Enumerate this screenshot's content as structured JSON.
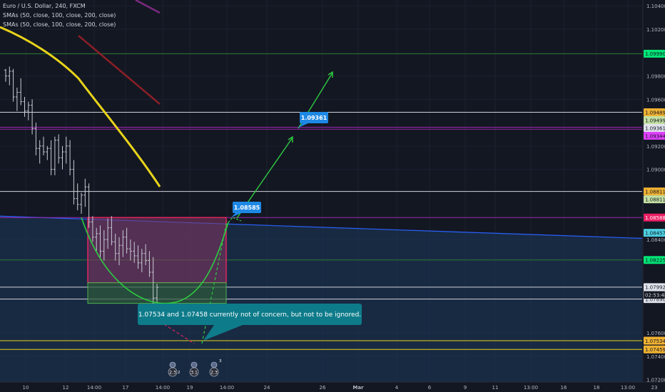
{
  "header": {
    "symbol": "Euro / U.S. Dollar, 240, FXCM",
    "indicators": [
      "SMAs (50, close, 100, close, 200, close)",
      "SMAs (50, close, 100, close, 200, close)"
    ]
  },
  "colors": {
    "background": "#131722",
    "candle": "#c8cbd2",
    "sma50": "#e8d31a",
    "sma100": "#8b1f26",
    "sma200": "#7a2a7e",
    "trendline": "#2962ff",
    "pink_zone": "#e0245e",
    "green_zone": "#4caf50",
    "projection": "#2ecc40",
    "label_blue": "#1e88e5",
    "note_bg": "#0e7b8a"
  },
  "annotations": {
    "label_upper": "1.09361",
    "label_mid": "1.08585",
    "note": "1.07534 and 1.07458 currently not of concern, but not to be ignored.",
    "bubbles": [
      {
        "value": "2.3",
        "sub": "2"
      },
      {
        "value": "3.1",
        "sub": ""
      },
      {
        "value": "2.3",
        "sub": "3"
      }
    ]
  },
  "chart_data": {
    "type": "candlestick",
    "title": "Euro / U.S. Dollar, 240, FXCM",
    "ylim": [
      1.0718,
      1.1045
    ],
    "x_ticks": [
      "10",
      "12",
      "14:00",
      "17",
      "14:00",
      "19",
      "14:00",
      "24",
      "26",
      "Mar",
      "4",
      "6",
      "9",
      "11",
      "13:00",
      "16",
      "18",
      "13:00",
      "23"
    ],
    "y_ticks": [
      "1.10400",
      "1.10200",
      "1.09800",
      "1.09600",
      "1.09200",
      "1.09000",
      "1.08400",
      "1.07600",
      "1.07400",
      "1.07200"
    ],
    "countdown": "02:53:48",
    "price_lines": [
      {
        "value": "1.09990",
        "bg": "#00e676",
        "fg": "#131722",
        "line": "#2e7d32"
      },
      {
        "value": "1.09489",
        "bg": "#f0b232",
        "fg": "#131722",
        "line": "#d1d4dc"
      },
      {
        "value": "1.09499",
        "bg": "#c5e1a5",
        "fg": "#131722",
        "line": ""
      },
      {
        "value": "1.09361",
        "bg": "#e0e3eb",
        "fg": "#131722",
        "line": "#9c27b0"
      },
      {
        "value": "1.09344",
        "bg": "#e040fb",
        "fg": "#131722",
        "line": "#9c27b0"
      },
      {
        "value": "1.08811",
        "bg": "#f0b232",
        "fg": "#131722",
        "line": "#d1d4dc"
      },
      {
        "value": "1.08811",
        "bg": "#c5e1a5",
        "fg": "#131722",
        "line": ""
      },
      {
        "value": "1.08588",
        "bg": "#e91e63",
        "fg": "#ffffff",
        "line": "#9c27b0"
      },
      {
        "value": "1.08457",
        "bg": "#4dd0e1",
        "fg": "#131722",
        "line": ""
      },
      {
        "value": "1.08225",
        "bg": "#00e676",
        "fg": "#131722",
        "line": "#2e7d32"
      },
      {
        "value": "1.07992",
        "bg": "#e0e3eb",
        "fg": "#131722",
        "line": "#d1d4dc"
      },
      {
        "value": "1.07890",
        "bg": "#e0e3eb",
        "fg": "#131722",
        "line": "#d1d4dc"
      },
      {
        "value": "1.07534",
        "bg": "#f0b232",
        "fg": "#131722",
        "line": "#e8d31a"
      },
      {
        "value": "1.07459",
        "bg": "#f0b232",
        "fg": "#131722",
        "line": "#e8d31a"
      }
    ],
    "candles": [
      [
        1.0985,
        1.0986,
        1.0975,
        1.098
      ],
      [
        1.098,
        1.0988,
        1.0972,
        1.0984
      ],
      [
        1.0984,
        1.0986,
        1.0958,
        1.0962
      ],
      [
        1.0962,
        1.097,
        1.095,
        1.0966
      ],
      [
        1.0966,
        1.0978,
        1.0955,
        1.0958
      ],
      [
        1.0958,
        1.0962,
        1.0945,
        1.095
      ],
      [
        1.095,
        1.0958,
        1.0942,
        1.0955
      ],
      [
        1.0955,
        1.096,
        1.093,
        1.0935
      ],
      [
        1.0935,
        1.094,
        1.0912,
        1.0918
      ],
      [
        1.0918,
        1.0925,
        1.0905,
        1.092
      ],
      [
        1.092,
        1.0928,
        1.0912,
        1.0915
      ],
      [
        1.0915,
        1.092,
        1.0908,
        1.0918
      ],
      [
        1.0918,
        1.0925,
        1.0895,
        1.09
      ],
      [
        1.09,
        1.0928,
        1.0895,
        1.0925
      ],
      [
        1.0925,
        1.093,
        1.0905,
        1.091
      ],
      [
        1.091,
        1.092,
        1.09,
        1.0915
      ],
      [
        1.0915,
        1.0928,
        1.0905,
        1.092
      ],
      [
        1.092,
        1.0925,
        1.0895,
        1.09
      ],
      [
        1.09,
        1.0908,
        1.087,
        1.0875
      ],
      [
        1.0875,
        1.0888,
        1.0865,
        1.087
      ],
      [
        1.087,
        1.088,
        1.0862,
        1.0878
      ],
      [
        1.0878,
        1.0892,
        1.0868,
        1.0885
      ],
      [
        1.0885,
        1.0888,
        1.085,
        1.0855
      ],
      [
        1.0855,
        1.086,
        1.0838,
        1.0842
      ],
      [
        1.0842,
        1.085,
        1.083,
        1.0845
      ],
      [
        1.0845,
        1.0852,
        1.0825,
        1.083
      ],
      [
        1.083,
        1.0848,
        1.0822,
        1.084
      ],
      [
        1.084,
        1.0858,
        1.0832,
        1.085
      ],
      [
        1.085,
        1.086,
        1.0835,
        1.0838
      ],
      [
        1.0838,
        1.0845,
        1.0822,
        1.0828
      ],
      [
        1.0828,
        1.0842,
        1.0818,
        1.0835
      ],
      [
        1.0835,
        1.0848,
        1.0825,
        1.0842
      ],
      [
        1.0842,
        1.085,
        1.0828,
        1.0832
      ],
      [
        1.0832,
        1.084,
        1.0822,
        1.083
      ],
      [
        1.083,
        1.0838,
        1.082,
        1.0826
      ],
      [
        1.0826,
        1.0835,
        1.0815,
        1.082
      ],
      [
        1.082,
        1.0832,
        1.0812,
        1.0828
      ],
      [
        1.0828,
        1.0836,
        1.0818,
        1.0822
      ],
      [
        1.0822,
        1.083,
        1.0808,
        1.0812
      ],
      [
        1.0812,
        1.0825,
        1.078,
        1.079
      ],
      [
        1.079,
        1.0802,
        1.0786,
        1.0799
      ]
    ]
  }
}
